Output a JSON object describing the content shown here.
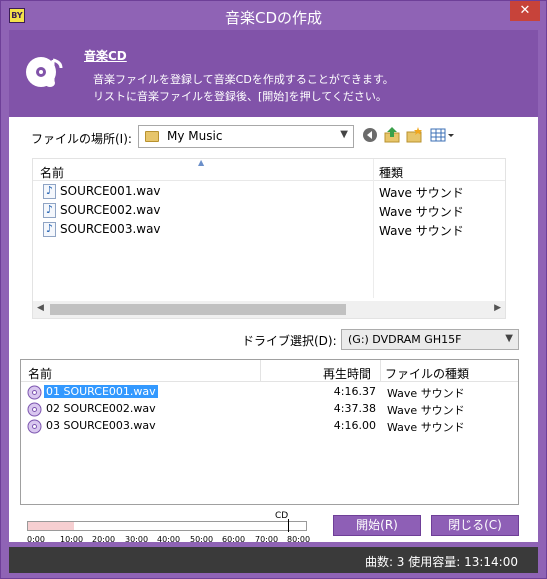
{
  "window": {
    "title": "音楽CDの作成",
    "app_icon_text": "BY",
    "close_label": "✕"
  },
  "header": {
    "title": "音楽CD",
    "desc_line1": "音楽ファイルを登録して音楽CDを作成することができます。",
    "desc_line2": "リストに音楽ファイルを登録後、[開始]を押してください。"
  },
  "location": {
    "label": "ファイルの場所(I):",
    "value": "My Music"
  },
  "file_list": {
    "columns": [
      "名前",
      "種類"
    ],
    "rows": [
      {
        "name": "SOURCE001.wav",
        "type": "Wave サウンド"
      },
      {
        "name": "SOURCE002.wav",
        "type": "Wave サウンド"
      },
      {
        "name": "SOURCE003.wav",
        "type": "Wave サウンド"
      }
    ]
  },
  "drive": {
    "label": "ドライブ選択(D):",
    "value": "(G:) DVDRAM GH15F"
  },
  "track_list": {
    "columns": [
      "名前",
      "再生時間",
      "ファイルの種類"
    ],
    "rows": [
      {
        "name": "01 SOURCE001.wav",
        "time": "4:16.37",
        "type": "Wave サウンド",
        "selected": true
      },
      {
        "name": "02 SOURCE002.wav",
        "time": "4:37.38",
        "type": "Wave サウンド",
        "selected": false
      },
      {
        "name": "03 SOURCE003.wav",
        "time": "4:16.00",
        "type": "Wave サウンド",
        "selected": false
      }
    ]
  },
  "gauge": {
    "cd_label": "CD",
    "ticks": [
      "0:00",
      "10:00",
      "20:00",
      "30:00",
      "40:00",
      "50:00",
      "60:00",
      "70:00",
      "80:00"
    ],
    "used_fraction": 0.165,
    "colors": {
      "fill": "#f6cfd1",
      "accent": "#bfe3ef"
    }
  },
  "buttons": {
    "start": "開始(R)",
    "close": "閉じる(C)"
  },
  "status": {
    "text": "曲数: 3  使用容量: 13:14:00"
  },
  "colors": {
    "accent": "#8f63b5",
    "header": "#8153a9",
    "selection": "#3399ff",
    "statusbar": "#3a3a3a"
  }
}
